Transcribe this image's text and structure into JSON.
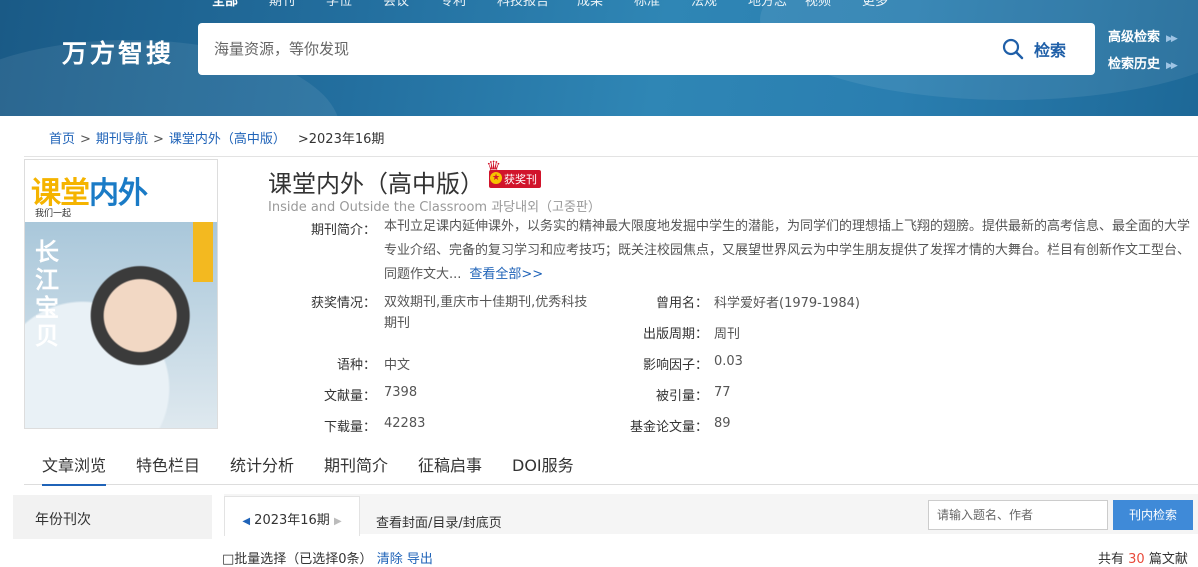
{
  "header": {
    "nav": [
      "全部",
      "期刊",
      "学位",
      "会议",
      "专利",
      "科技报告",
      "成果",
      "标准",
      "法规",
      "地方志",
      "视频",
      "更多"
    ],
    "logo": "万方智搜",
    "search_placeholder": "海量资源，等你发现",
    "search_button": "检索",
    "advanced_search": "高级检索",
    "search_history": "检索历史"
  },
  "breadcrumb": {
    "home": "首页",
    "journal_nav": "期刊导航",
    "journal": "课堂内外（高中版）",
    "issue": ">2023年16期"
  },
  "journal": {
    "title": "课堂内外（高中版）",
    "badge": "获奖刊",
    "english_title": "Inside and Outside the Classroom 과당내외（고중판）",
    "cover": {
      "name_part1": "课堂",
      "name_part2": "内外",
      "sub": "我们一起",
      "vertical": "长江宝贝"
    },
    "intro_label": "期刊简介：",
    "intro": "本刊立足课内延伸课外，以务实的精神最大限度地发掘中学生的潜能，为同学们的理想插上飞翔的翅膀。提供最新的高考信息、最全面的大学专业介绍、完备的复习学习和应考技巧；既关注校园焦点，又展望世界风云为中学生朋友提供了发挥才情的大舞台。栏目有创新作文工型台、同题作文大...",
    "intro_more": "查看全部>>",
    "fields": {
      "award_label": "获奖情况：",
      "award_value": "双效期刊,重庆市十佳期刊,优秀科技期刊",
      "former_label": "曾用名：",
      "former_value": "科学爱好者(1979-1984)",
      "period_label": "出版周期：",
      "period_value": "周刊",
      "lang_label": "语种：",
      "lang_value": "中文",
      "impact_label": "影响因子：",
      "impact_value": "0.03",
      "docs_label": "文献量：",
      "docs_value": "7398",
      "cited_label": "被引量：",
      "cited_value": "77",
      "downloads_label": "下载量：",
      "downloads_value": "42283",
      "fund_label": "基金论文量：",
      "fund_value": "89"
    }
  },
  "tabs": [
    "文章浏览",
    "特色栏目",
    "统计分析",
    "期刊简介",
    "征稿启事",
    "DOI服务"
  ],
  "content": {
    "sidebar_title": "年份刊次",
    "year_issue": "2023年16期",
    "cover_link": "查看封面/目录/封底页",
    "inner_search_placeholder": "请输入题名、作者",
    "inner_search_button": "刊内检索",
    "batch_select": "□批量选择（已选择0条）",
    "clear": "清除",
    "export": "导出",
    "total_prefix": "共有",
    "total_count": "30",
    "total_suffix": "篇文献"
  }
}
